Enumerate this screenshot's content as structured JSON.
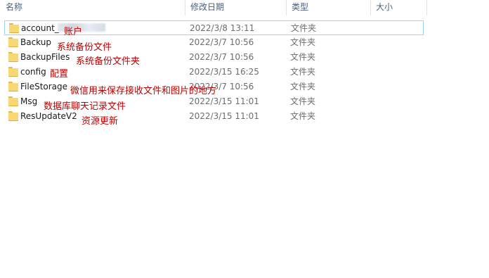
{
  "columns": {
    "name": "名称",
    "modified": "修改日期",
    "type": "类型",
    "size": "大小"
  },
  "files": [
    {
      "name": "account_",
      "date": "2022/3/8 13:11",
      "type": "文件夹",
      "note": "账户"
    },
    {
      "name": "Backup",
      "date": "2022/3/7 10:56",
      "type": "文件夹",
      "note": "系统备份文件"
    },
    {
      "name": "BackupFiles",
      "date": "2022/3/7 10:56",
      "type": "文件夹",
      "note": "系统备份文件夹"
    },
    {
      "name": "config",
      "date": "2022/3/15 16:25",
      "type": "文件夹",
      "note": "配置"
    },
    {
      "name": "FileStorage",
      "date": "2022/3/7 10:56",
      "type": "文件夹",
      "note": "微信用来保存接收文件和图片的地方"
    },
    {
      "name": "Msg",
      "date": "2022/3/15 11:01",
      "type": "文件夹",
      "note": "数据库聊天记录文件"
    },
    {
      "name": "ResUpdateV2",
      "date": "2022/3/15 11:01",
      "type": "文件夹",
      "note": "资源更新"
    }
  ],
  "colors": {
    "annotation": "#c00000",
    "selection_border": "#99d1ff",
    "folder": "#f8d775"
  },
  "icons": {
    "folder": "folder-icon"
  }
}
